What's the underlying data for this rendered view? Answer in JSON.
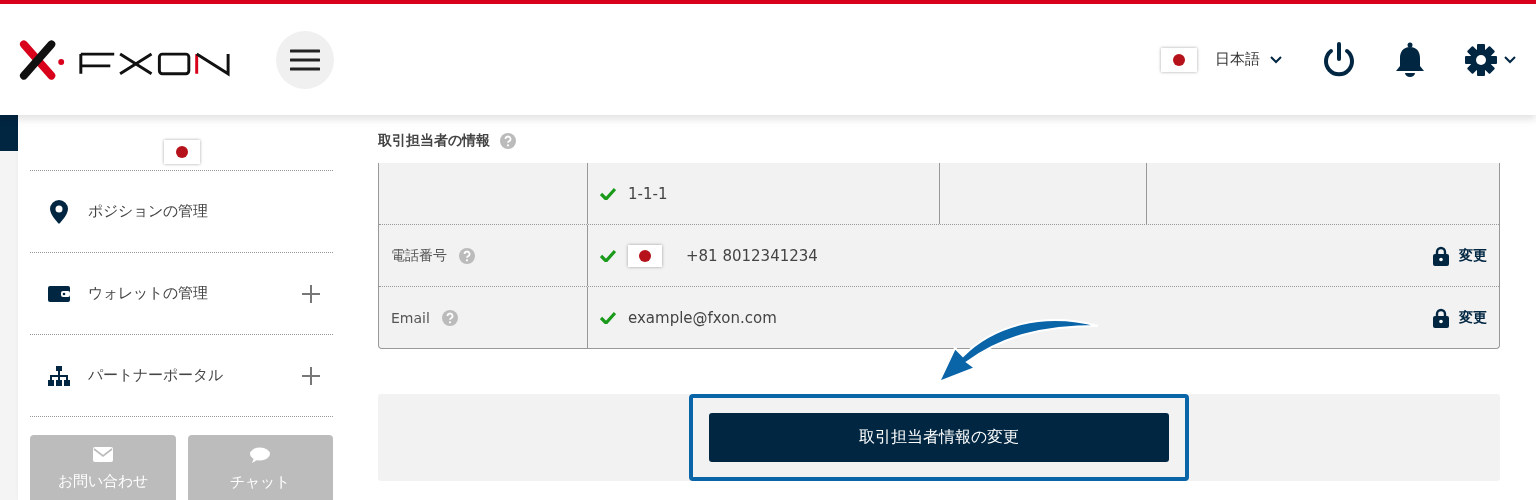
{
  "header": {
    "language": "日本語"
  },
  "sidebar": {
    "items": [
      {
        "label": "ポジションの管理",
        "kind": "pin",
        "expandable": false
      },
      {
        "label": "ウォレットの管理",
        "kind": "wallet",
        "expandable": true
      },
      {
        "label": "パートナーポータル",
        "kind": "tree",
        "expandable": true
      }
    ],
    "buttons": [
      {
        "label": "お問い合わせ",
        "kind": "mail"
      },
      {
        "label": "チャット",
        "kind": "chat"
      }
    ]
  },
  "section": {
    "title": "取引担当者の情報",
    "rows": [
      {
        "kind": "address",
        "value": "1-1-1",
        "verified": true
      },
      {
        "kind": "phone",
        "label": "電話番号",
        "value": "+81 8012341234",
        "verified": true,
        "action": "変更"
      },
      {
        "kind": "email",
        "label": "Email",
        "value": "example@fxon.com",
        "verified": true,
        "action": "変更"
      }
    ]
  },
  "submit": {
    "label": "取引担当者情報の変更",
    "highlighted": true
  }
}
